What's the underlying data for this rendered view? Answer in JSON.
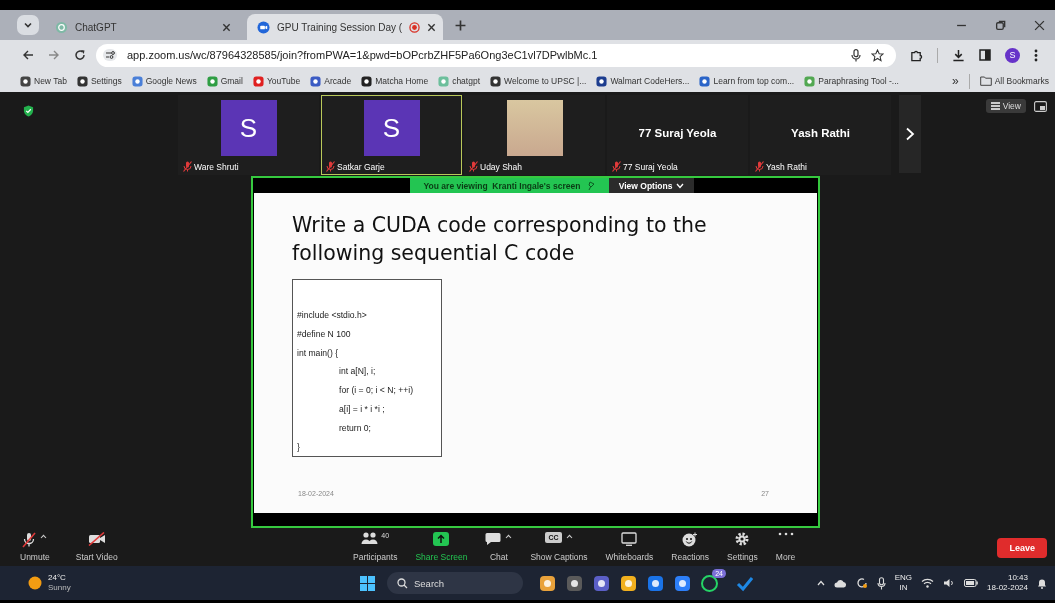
{
  "browser": {
    "tabs": [
      {
        "title": "ChatGPT",
        "selected": false,
        "recording": false
      },
      {
        "title": "GPU Training Session Day (",
        "selected": true,
        "recording": true
      }
    ],
    "url": "app.zoom.us/wc/87964328585/join?fromPWA=1&pwd=bOPcrbZHF5Pa6Ong3eC1vl7DPwlbMc.1",
    "profile_initial": "S",
    "bookmarks": [
      "New Tab",
      "Settings",
      "Google News",
      "Gmail",
      "YouTube",
      "Arcade",
      "Matcha Home",
      "chatgpt",
      "Welcome to UPSC |...",
      "Walmart CodeHers...",
      "Learn from top com...",
      "Paraphrasing Tool -..."
    ],
    "bookmark_overflow": "»",
    "all_bookmarks": "All Bookmarks"
  },
  "meeting": {
    "view_button": "View",
    "participants": [
      {
        "name": "Ware Shruti",
        "kind": "avatar",
        "initial": "S",
        "muted": true,
        "active_speaker": false
      },
      {
        "name": "Satkar Garje",
        "kind": "avatar",
        "initial": "S",
        "muted": true,
        "active_speaker": true
      },
      {
        "name": "Uday Shah",
        "kind": "photo",
        "muted": true,
        "active_speaker": false
      },
      {
        "name": "77 Suraj Yeola",
        "kind": "name",
        "big_name": "77 Suraj Yeola",
        "muted": true,
        "active_speaker": false
      },
      {
        "name": "Yash Rathi",
        "kind": "name",
        "big_name": "Yash Rathi",
        "muted": true,
        "active_speaker": false
      }
    ],
    "share_banner": "You are viewing  Kranti Ingale's screen",
    "view_options": "View Options",
    "slide": {
      "title": "Write a CUDA code corresponding to the following sequential C code",
      "code": [
        {
          "text": "#include <stdio.h>",
          "kind": "outer"
        },
        {
          "text": "#define N 100",
          "kind": "outer"
        },
        {
          "text": "int main() {",
          "kind": "outer"
        },
        {
          "text": "int a[N], i;",
          "kind": "inner"
        },
        {
          "text": "for (i = 0; i < N; ++i)",
          "kind": "inner"
        },
        {
          "text": "a[i] = i * i *i ;",
          "kind": "inner"
        },
        {
          "text": "return 0;",
          "kind": "inner"
        },
        {
          "text": "}",
          "kind": "outer"
        }
      ],
      "date": "18-02-2024",
      "page": "27"
    },
    "toolbar_left": [
      {
        "label": "Unmute",
        "kind": "mic",
        "caret": true
      },
      {
        "label": "Start Video",
        "kind": "video",
        "caret": false
      }
    ],
    "toolbar_center": [
      {
        "label": "Participants",
        "kind": "people",
        "caret": false,
        "badge": "40"
      },
      {
        "label": "Share Screen",
        "kind": "share",
        "caret": false
      },
      {
        "label": "Chat",
        "kind": "chat",
        "caret": true
      },
      {
        "label": "Show Captions",
        "kind": "cc",
        "caret": true,
        "icon_text": "CC"
      },
      {
        "label": "Whiteboards",
        "kind": "board",
        "caret": false
      },
      {
        "label": "Reactions",
        "kind": "smile",
        "caret": false
      },
      {
        "label": "Settings",
        "kind": "gear",
        "caret": false
      },
      {
        "label": "More",
        "kind": "more",
        "caret": false
      }
    ],
    "leave": "Leave"
  },
  "taskbar": {
    "temperature": "24°C",
    "condition": "Sunny",
    "search": "Search",
    "whatsapp_badge": "24",
    "lang": "ENG",
    "region": "IN",
    "time": "10:43",
    "date": "18-02-2024"
  }
}
